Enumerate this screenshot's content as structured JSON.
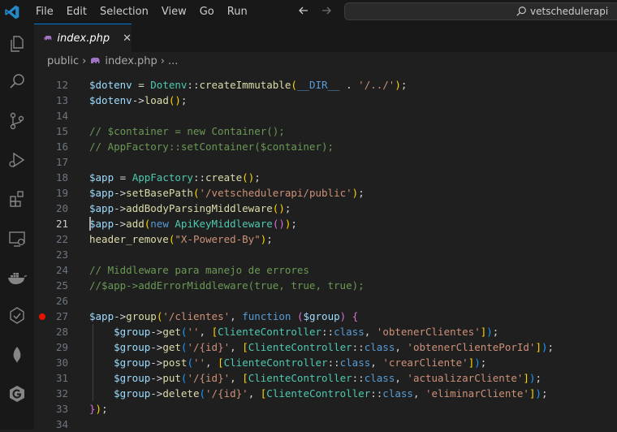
{
  "titlebar": {
    "menu": [
      "File",
      "Edit",
      "Selection",
      "View",
      "Go",
      "Run"
    ],
    "search_text": "vetschedulerapi"
  },
  "activity_icons": [
    "explorer-icon",
    "search-icon",
    "source-control-icon",
    "run-debug-icon",
    "extensions-icon",
    "remote-explorer-icon",
    "docker-icon",
    "testing-icon",
    "mongodb-icon",
    "gitkraken-icon"
  ],
  "tab": {
    "label": "index.php",
    "close": "✕"
  },
  "breadcrumb": {
    "folder": "public",
    "file": "index.php",
    "more": "..."
  },
  "editor": {
    "active_line": 21,
    "breakpoint_line": 27,
    "lines": [
      {
        "n": "12",
        "t": [
          [
            "v",
            "$dotenv"
          ],
          [
            "o",
            " = "
          ],
          [
            "c",
            "Dotenv"
          ],
          [
            "o",
            "::"
          ],
          [
            "f",
            "createImmutable"
          ],
          [
            "p1",
            "("
          ],
          [
            "k",
            "__DIR__"
          ],
          [
            "o",
            " . "
          ],
          [
            "s",
            "'/../'"
          ],
          [
            "p1",
            ")"
          ],
          [
            "o",
            ";"
          ]
        ]
      },
      {
        "n": "13",
        "t": [
          [
            "v",
            "$dotenv"
          ],
          [
            "o",
            "->"
          ],
          [
            "f",
            "load"
          ],
          [
            "p1",
            "()"
          ],
          [
            "o",
            ";"
          ]
        ]
      },
      {
        "n": "14",
        "t": []
      },
      {
        "n": "15",
        "t": [
          [
            "cm",
            "// $container = new Container();"
          ]
        ]
      },
      {
        "n": "16",
        "t": [
          [
            "cm",
            "// AppFactory::setContainer($container);"
          ]
        ]
      },
      {
        "n": "17",
        "t": []
      },
      {
        "n": "18",
        "t": [
          [
            "v",
            "$app"
          ],
          [
            "o",
            " = "
          ],
          [
            "c",
            "AppFactory"
          ],
          [
            "o",
            "::"
          ],
          [
            "f",
            "create"
          ],
          [
            "p1",
            "()"
          ],
          [
            "o",
            ";"
          ]
        ]
      },
      {
        "n": "19",
        "t": [
          [
            "v",
            "$app"
          ],
          [
            "o",
            "->"
          ],
          [
            "f",
            "setBasePath"
          ],
          [
            "p1",
            "("
          ],
          [
            "s",
            "'/vetschedulerapi/public'"
          ],
          [
            "p1",
            ")"
          ],
          [
            "o",
            ";"
          ]
        ]
      },
      {
        "n": "20",
        "t": [
          [
            "v",
            "$app"
          ],
          [
            "o",
            "->"
          ],
          [
            "f",
            "addBodyParsingMiddleware"
          ],
          [
            "p1",
            "()"
          ],
          [
            "o",
            ";"
          ]
        ]
      },
      {
        "n": "21",
        "t": [
          [
            "v",
            "$app"
          ],
          [
            "o",
            "->"
          ],
          [
            "f",
            "add"
          ],
          [
            "p1",
            "("
          ],
          [
            "kw",
            "new "
          ],
          [
            "c",
            "ApiKeyMiddleware"
          ],
          [
            "p2",
            "()"
          ],
          [
            "p1",
            ")"
          ],
          [
            "o",
            ";"
          ]
        ]
      },
      {
        "n": "22",
        "t": [
          [
            "f",
            "header_remove"
          ],
          [
            "p1",
            "("
          ],
          [
            "s",
            "\"X-Powered-By\""
          ],
          [
            "p1",
            ")"
          ],
          [
            "o",
            ";"
          ]
        ]
      },
      {
        "n": "23",
        "t": []
      },
      {
        "n": "24",
        "t": [
          [
            "cm",
            "// Middleware para manejo de errores"
          ]
        ]
      },
      {
        "n": "25",
        "t": [
          [
            "cm",
            "//$app->addErrorMiddleware(true, true, true);"
          ]
        ]
      },
      {
        "n": "26",
        "t": []
      },
      {
        "n": "27",
        "t": [
          [
            "v",
            "$app"
          ],
          [
            "o",
            "->"
          ],
          [
            "f",
            "group"
          ],
          [
            "p1",
            "("
          ],
          [
            "s",
            "'/clientes'"
          ],
          [
            "o",
            ", "
          ],
          [
            "kw",
            "function"
          ],
          [
            "o",
            " "
          ],
          [
            "p2",
            "("
          ],
          [
            "v",
            "$group"
          ],
          [
            "p2",
            ")"
          ],
          [
            "o",
            " "
          ],
          [
            "p2",
            "{"
          ]
        ]
      },
      {
        "n": "28",
        "t": [
          [
            "o",
            "    "
          ],
          [
            "v",
            "$group"
          ],
          [
            "o",
            "->"
          ],
          [
            "f",
            "get"
          ],
          [
            "p3",
            "("
          ],
          [
            "s",
            "''"
          ],
          [
            "o",
            ", "
          ],
          [
            "p1",
            "["
          ],
          [
            "c",
            "ClienteController"
          ],
          [
            "o",
            "::"
          ],
          [
            "kw",
            "class"
          ],
          [
            "o",
            ", "
          ],
          [
            "s",
            "'obtenerClientes'"
          ],
          [
            "p1",
            "]"
          ],
          [
            "p3",
            ")"
          ],
          [
            "o",
            ";"
          ]
        ]
      },
      {
        "n": "29",
        "t": [
          [
            "o",
            "    "
          ],
          [
            "v",
            "$group"
          ],
          [
            "o",
            "->"
          ],
          [
            "f",
            "get"
          ],
          [
            "p3",
            "("
          ],
          [
            "s",
            "'/{id}'"
          ],
          [
            "o",
            ", "
          ],
          [
            "p1",
            "["
          ],
          [
            "c",
            "ClienteController"
          ],
          [
            "o",
            "::"
          ],
          [
            "kw",
            "class"
          ],
          [
            "o",
            ", "
          ],
          [
            "s",
            "'obtenerClientePorId'"
          ],
          [
            "p1",
            "]"
          ],
          [
            "p3",
            ")"
          ],
          [
            "o",
            ";"
          ]
        ]
      },
      {
        "n": "30",
        "t": [
          [
            "o",
            "    "
          ],
          [
            "v",
            "$group"
          ],
          [
            "o",
            "->"
          ],
          [
            "f",
            "post"
          ],
          [
            "p3",
            "("
          ],
          [
            "s",
            "''"
          ],
          [
            "o",
            ", "
          ],
          [
            "p1",
            "["
          ],
          [
            "c",
            "ClienteController"
          ],
          [
            "o",
            "::"
          ],
          [
            "kw",
            "class"
          ],
          [
            "o",
            ", "
          ],
          [
            "s",
            "'crearCliente'"
          ],
          [
            "p1",
            "]"
          ],
          [
            "p3",
            ")"
          ],
          [
            "o",
            ";"
          ]
        ]
      },
      {
        "n": "31",
        "t": [
          [
            "o",
            "    "
          ],
          [
            "v",
            "$group"
          ],
          [
            "o",
            "->"
          ],
          [
            "f",
            "put"
          ],
          [
            "p3",
            "("
          ],
          [
            "s",
            "'/{id}'"
          ],
          [
            "o",
            ", "
          ],
          [
            "p1",
            "["
          ],
          [
            "c",
            "ClienteController"
          ],
          [
            "o",
            "::"
          ],
          [
            "kw",
            "class"
          ],
          [
            "o",
            ", "
          ],
          [
            "s",
            "'actualizarCliente'"
          ],
          [
            "p1",
            "]"
          ],
          [
            "p3",
            ")"
          ],
          [
            "o",
            ";"
          ]
        ]
      },
      {
        "n": "32",
        "t": [
          [
            "o",
            "    "
          ],
          [
            "v",
            "$group"
          ],
          [
            "o",
            "->"
          ],
          [
            "f",
            "delete"
          ],
          [
            "p3",
            "("
          ],
          [
            "s",
            "'/{id}'"
          ],
          [
            "o",
            ", "
          ],
          [
            "p1",
            "["
          ],
          [
            "c",
            "ClienteController"
          ],
          [
            "o",
            "::"
          ],
          [
            "kw",
            "class"
          ],
          [
            "o",
            ", "
          ],
          [
            "s",
            "'eliminarCliente'"
          ],
          [
            "p1",
            "]"
          ],
          [
            "p3",
            ")"
          ],
          [
            "o",
            ";"
          ]
        ]
      },
      {
        "n": "33",
        "t": [
          [
            "p2",
            "}"
          ],
          [
            "p1",
            ")"
          ],
          [
            "o",
            ";"
          ]
        ]
      },
      {
        "n": "34",
        "t": []
      }
    ]
  }
}
